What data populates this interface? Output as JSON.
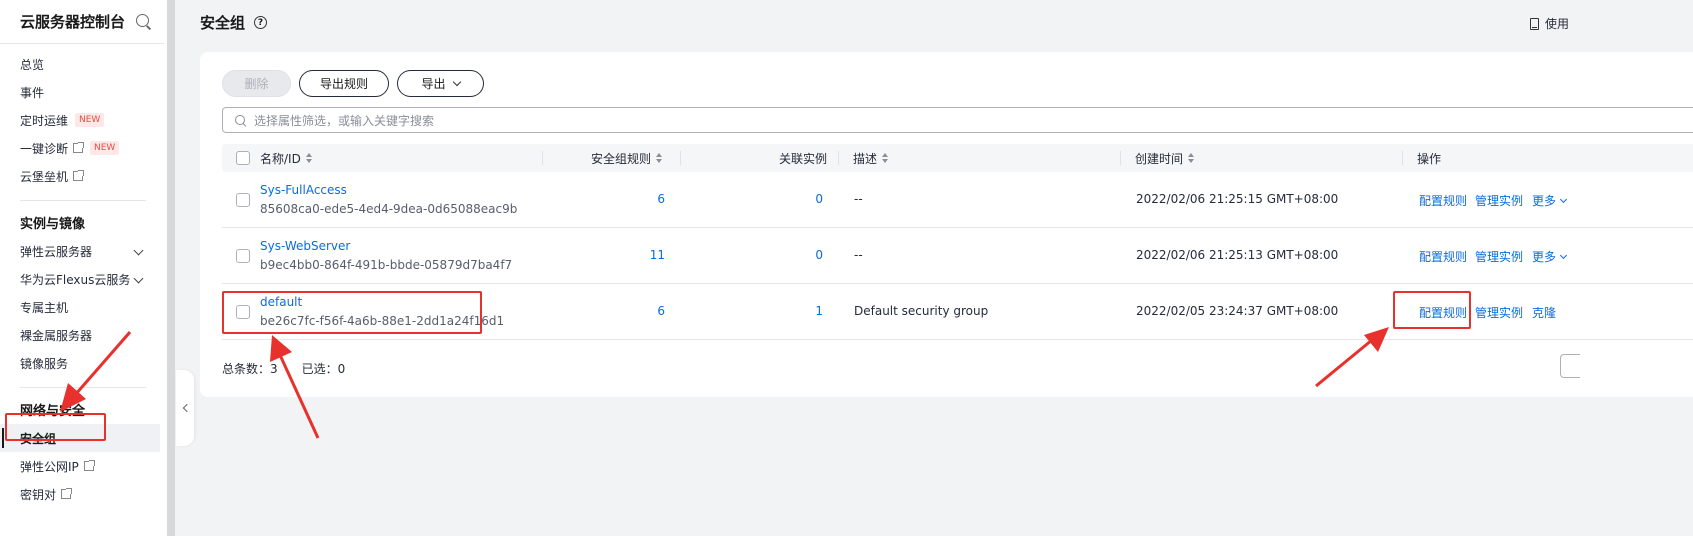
{
  "sidebar": {
    "title": "云服务器控制台",
    "items_top": [
      {
        "label": "总览"
      },
      {
        "label": "事件"
      },
      {
        "label": "定时运维",
        "badge": "NEW"
      },
      {
        "label": "一键诊断",
        "badge": "NEW"
      },
      {
        "label": "云堡垒机"
      }
    ],
    "group_instances": "实例与镜像",
    "items_instances": [
      {
        "label": "弹性云服务器"
      },
      {
        "label": "华为云Flexus云服务"
      },
      {
        "label": "专属主机"
      },
      {
        "label": "裸金属服务器"
      },
      {
        "label": "镜像服务"
      }
    ],
    "group_network": "网络与安全",
    "items_network": [
      {
        "label": "安全组"
      },
      {
        "label": "弹性公网IP"
      },
      {
        "label": "密钥对"
      }
    ]
  },
  "header": {
    "title": "安全组",
    "help": "?",
    "use_link": "使用"
  },
  "toolbar": {
    "delete_label": "删除",
    "export_rules_label": "导出规则",
    "export_label": "导出"
  },
  "search": {
    "placeholder": "选择属性筛选，或输入关键字搜索"
  },
  "table": {
    "columns": {
      "name": "名称/ID",
      "rules": "安全组规则",
      "instances": "关联实例",
      "desc": "描述",
      "created": "创建时间",
      "actions": "操作"
    },
    "rows": [
      {
        "name": "Sys-FullAccess",
        "id": "85608ca0-ede5-4ed4-9dea-0d65088eac9b",
        "rules": "6",
        "instances": "0",
        "desc": "--",
        "created": "2022/02/06 21:25:15 GMT+08:00",
        "action1": "配置规则",
        "action2": "管理实例",
        "action3": "更多"
      },
      {
        "name": "Sys-WebServer",
        "id": "b9ec4bb0-864f-491b-bbde-05879d7ba4f7",
        "rules": "11",
        "instances": "0",
        "desc": "--",
        "created": "2022/02/06 21:25:13 GMT+08:00",
        "action1": "配置规则",
        "action2": "管理实例",
        "action3": "更多"
      },
      {
        "name": "default",
        "id": "be26c7fc-f56f-4a6b-88e1-2dd1a24f16d1",
        "rules": "6",
        "instances": "1",
        "desc": "Default security group",
        "created": "2022/02/05 23:24:37 GMT+08:00",
        "action1": "配置规则",
        "action2": "管理实例",
        "action3": "克隆"
      }
    ]
  },
  "footer": {
    "total_label": "总条数：3",
    "selected_label": "已选：0"
  },
  "colors": {
    "link": "#0a6bdd",
    "annotation": "#e8302c"
  }
}
